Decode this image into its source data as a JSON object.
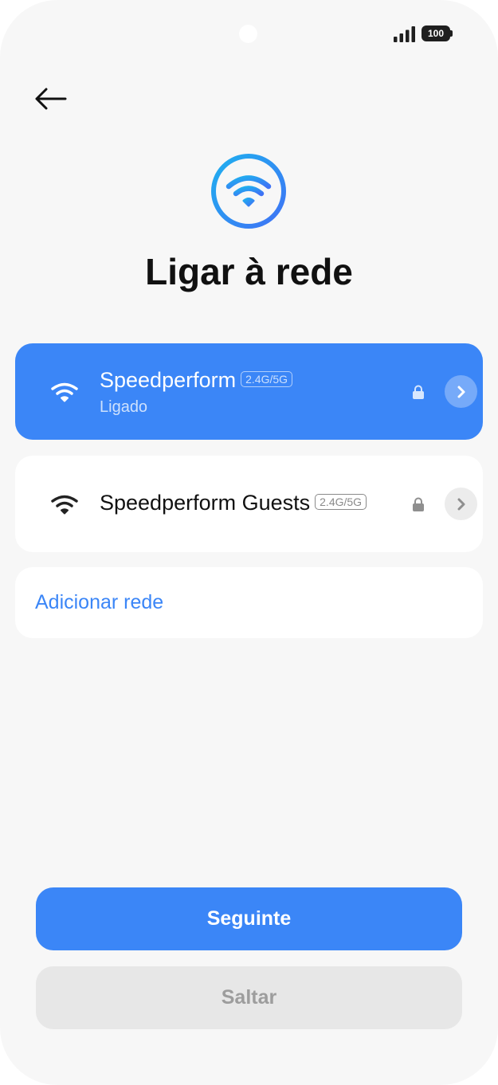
{
  "status_bar": {
    "battery_level": "100"
  },
  "header": {
    "title": "Ligar à rede"
  },
  "networks": [
    {
      "name": "Speedperform",
      "band": "2.4G/5G",
      "status": "Ligado",
      "connected": true,
      "secured": true
    },
    {
      "name": "Speedperform Guests",
      "band": "2.4G/5G",
      "status": "",
      "connected": false,
      "secured": true
    }
  ],
  "add_network": {
    "label": "Adicionar rede"
  },
  "buttons": {
    "next_label": "Seguinte",
    "skip_label": "Saltar"
  },
  "colors": {
    "accent": "#3b86f7",
    "background": "#f7f7f7",
    "card": "#ffffff"
  },
  "icons": {
    "back": "arrow-left-icon",
    "hero": "wifi-circle-icon",
    "network": "wifi-icon",
    "lock": "lock-icon",
    "detail": "chevron-right-icon"
  }
}
